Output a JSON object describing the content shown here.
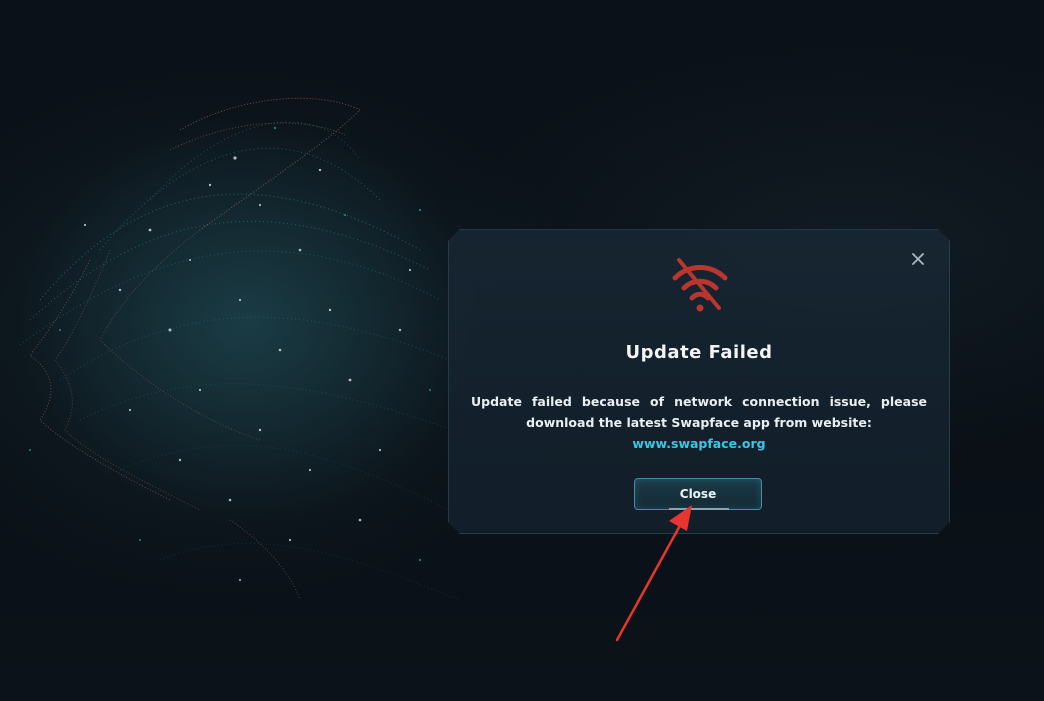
{
  "dialog": {
    "icon": "wifi-off-icon",
    "title": "Update Failed",
    "message_line1": "Update failed because of network connection issue, please",
    "message_line2": "download the latest Swapface app from website:",
    "link_text": "www.swapface.org",
    "close_button_label": "Close"
  },
  "colors": {
    "accent": "#3ec5e6",
    "error_icon": "#b8362e",
    "annotation_arrow": "#e8352f",
    "background": "#0a0f15"
  }
}
